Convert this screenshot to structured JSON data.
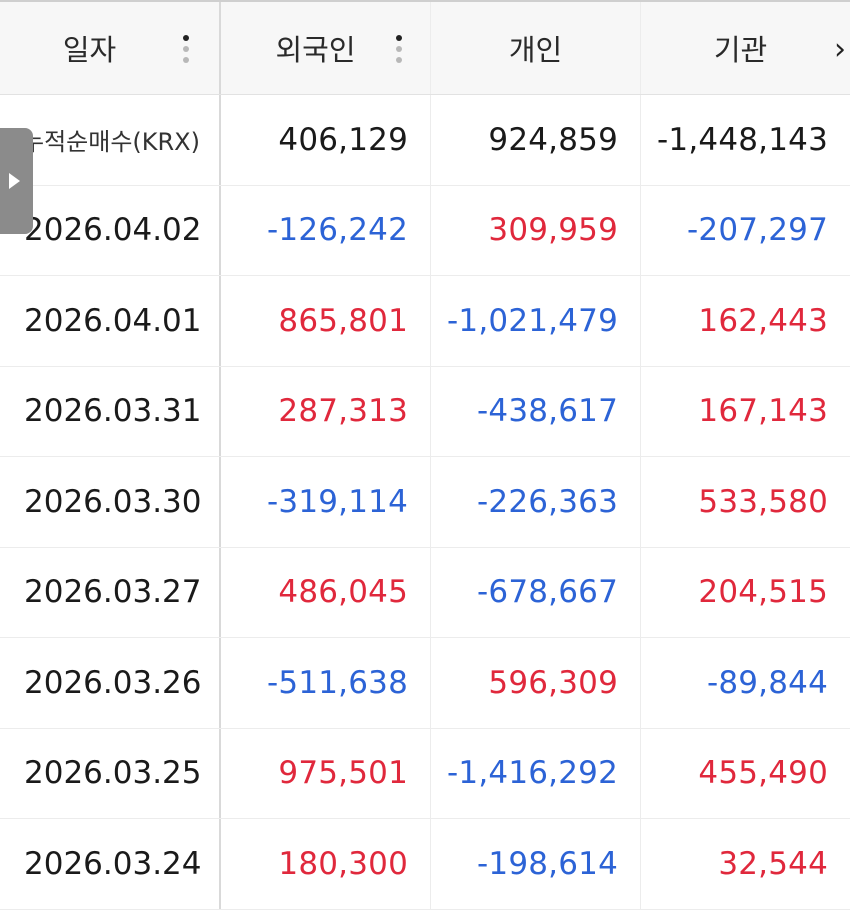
{
  "header": {
    "date": "일자",
    "foreign": "외국인",
    "individual": "개인",
    "institution": "기관"
  },
  "total": {
    "label": "누적순매수(KRX)",
    "foreign": "406,129",
    "individual": "924,859",
    "institution": "-1,448,143"
  },
  "rows": [
    {
      "date": "2026.04.02",
      "foreign": "-126,242",
      "individual": "309,959",
      "institution": "-207,297"
    },
    {
      "date": "2026.04.01",
      "foreign": "865,801",
      "individual": "-1,021,479",
      "institution": "162,443"
    },
    {
      "date": "2026.03.31",
      "foreign": "287,313",
      "individual": "-438,617",
      "institution": "167,143"
    },
    {
      "date": "2026.03.30",
      "foreign": "-319,114",
      "individual": "-226,363",
      "institution": "533,580"
    },
    {
      "date": "2026.03.27",
      "foreign": "486,045",
      "individual": "-678,667",
      "institution": "204,515"
    },
    {
      "date": "2026.03.26",
      "foreign": "-511,638",
      "individual": "596,309",
      "institution": "-89,844"
    },
    {
      "date": "2026.03.25",
      "foreign": "975,501",
      "individual": "-1,416,292",
      "institution": "455,490"
    },
    {
      "date": "2026.03.24",
      "foreign": "180,300",
      "individual": "-198,614",
      "institution": "32,544"
    }
  ],
  "colors": {
    "positive": "#e0283c",
    "negative": "#2c63d6",
    "header_bg": "#f7f7f7"
  },
  "icons": {
    "column_menu": "kebab-vertical-icon",
    "scroll_right": "chevron-right-icon",
    "side_panel": "play-triangle-icon"
  }
}
